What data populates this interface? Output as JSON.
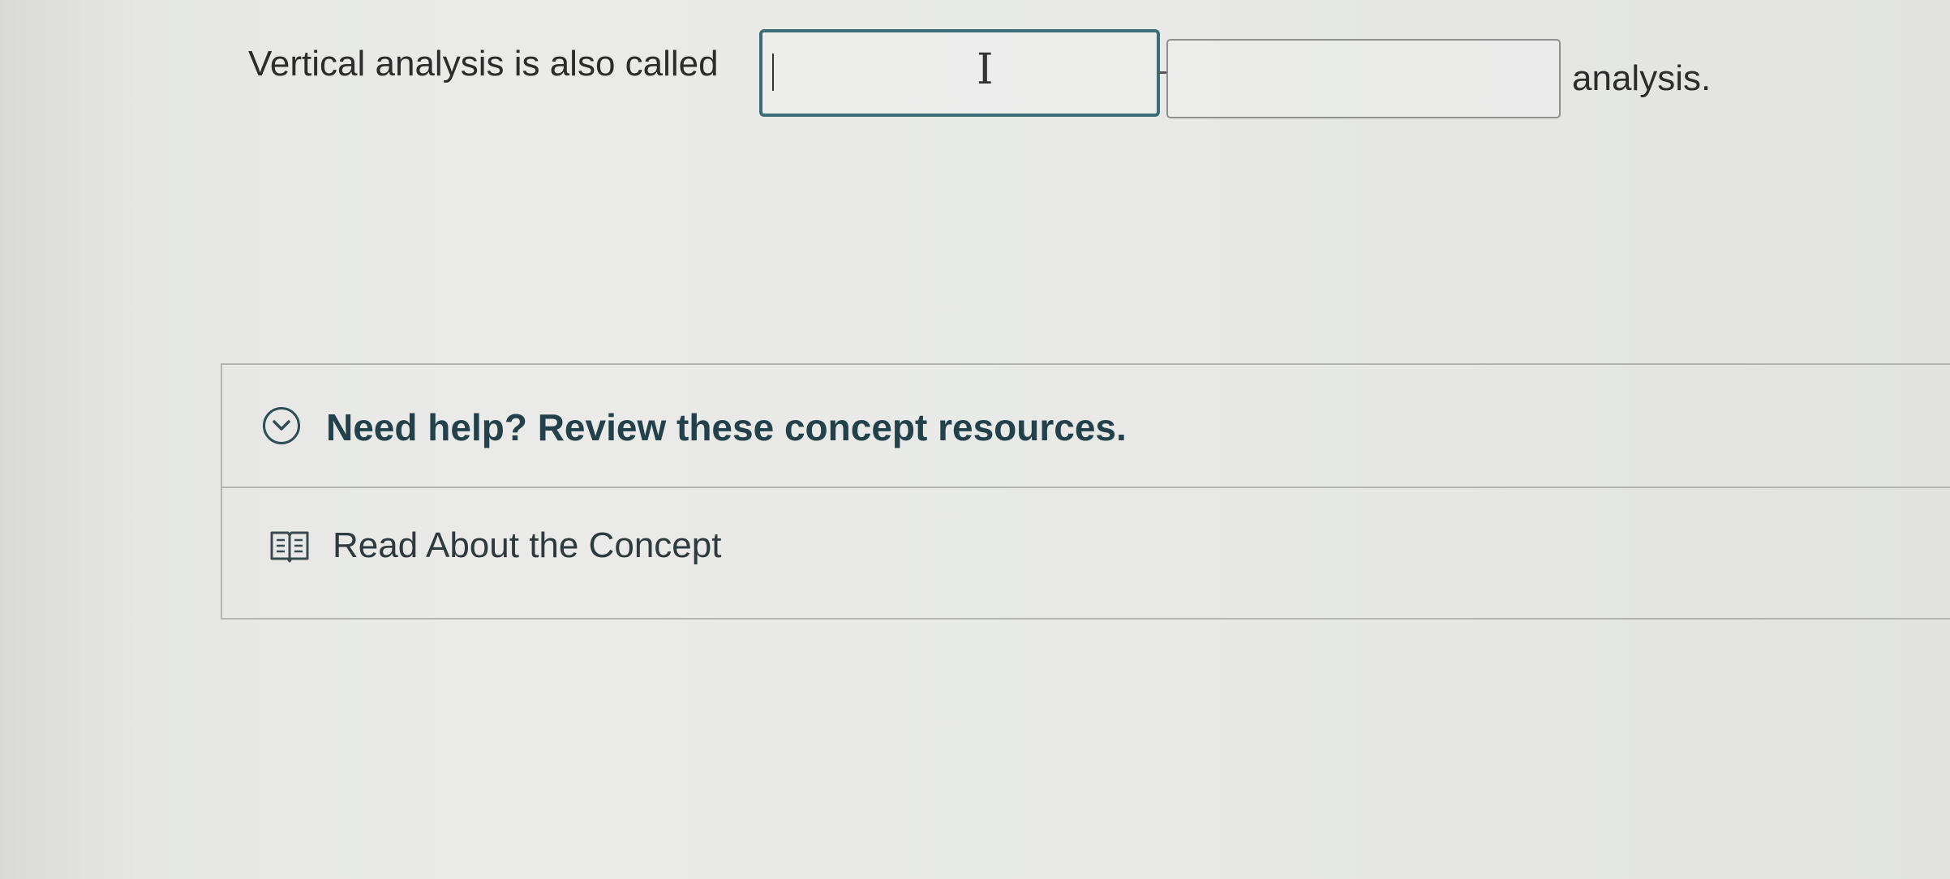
{
  "question": {
    "prefix": "Vertical analysis is also called",
    "input_1": {
      "value": "",
      "placeholder": ""
    },
    "input_2": {
      "value": "",
      "placeholder": ""
    },
    "suffix": "analysis."
  },
  "help": {
    "title": "Need help? Review these concept resources.",
    "resources": [
      {
        "label": "Read About the Concept",
        "icon": "book-icon"
      }
    ]
  },
  "colors": {
    "active_border": "#3d6e78",
    "heading": "#23414a",
    "panel_border": "#b4b5b3"
  }
}
